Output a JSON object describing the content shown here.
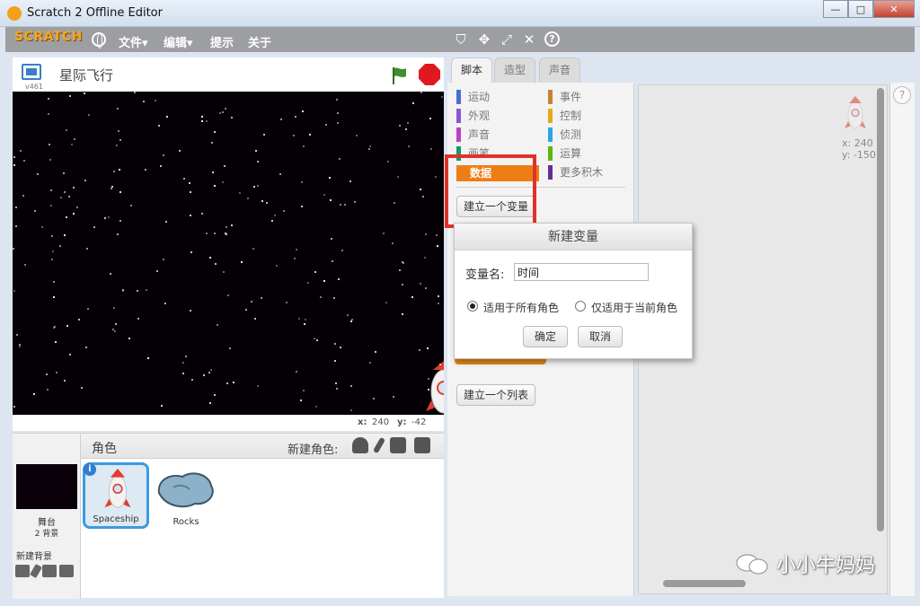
{
  "window": {
    "title": "Scratch 2 Offline Editor",
    "buttons": {
      "minimize": "—",
      "maximize": "□",
      "close": "✕"
    }
  },
  "menubar": {
    "logo": "SCRATCH",
    "items": [
      "文件▾",
      "编辑▾",
      "提示",
      "关于"
    ],
    "tools": [
      "stamp-icon",
      "cut-icon",
      "grow-icon",
      "shrink-icon",
      "help-icon"
    ]
  },
  "stage": {
    "version": "v461",
    "project_title": "星际飞行",
    "x_label": "x:",
    "x_value": "240",
    "y_label": "y:",
    "y_value": "-42"
  },
  "sprites": {
    "header_label": "角色",
    "new_sprite_label": "新建角色:",
    "stage_label": "舞台",
    "stage_backdrops": "2 背景",
    "new_backdrop_label": "新建背景",
    "items": [
      {
        "name": "Spaceship",
        "selected": true
      },
      {
        "name": "Rocks",
        "selected": false
      }
    ]
  },
  "tabs": [
    "脚本",
    "造型",
    "声音"
  ],
  "categories": {
    "left": [
      {
        "label": "运动",
        "color": "#4a6cd4"
      },
      {
        "label": "外观",
        "color": "#8a55d7"
      },
      {
        "label": "声音",
        "color": "#bb42c3"
      },
      {
        "label": "画笔",
        "color": "#0e9a6c"
      },
      {
        "label": "数据",
        "color": "#ee7d16"
      }
    ],
    "right": [
      {
        "label": "事件",
        "color": "#c88330"
      },
      {
        "label": "控制",
        "color": "#e1a91a"
      },
      {
        "label": "侦测",
        "color": "#2ca5e2"
      },
      {
        "label": "运算",
        "color": "#5cb712"
      },
      {
        "label": "更多积木",
        "color": "#632d99"
      }
    ]
  },
  "palette": {
    "make_variable": "建立一个变量",
    "make_list": "建立一个列表"
  },
  "dialog": {
    "title": "新建变量",
    "name_label": "变量名:",
    "name_value": "时间",
    "option_all": "适用于所有角色",
    "option_this": "仅适用于当前角色",
    "ok": "确定",
    "cancel": "取消"
  },
  "script_area": {
    "x_label": "x: 240",
    "y_label": "y: -150",
    "help": "?"
  },
  "watermark": "小小牛妈妈",
  "colors": {
    "highlight": "#e0312a",
    "data_category": "#ee7d16",
    "stop": "#e0191f",
    "flag": "#3f8f2c",
    "selected_sprite": "#3b9ae1"
  }
}
